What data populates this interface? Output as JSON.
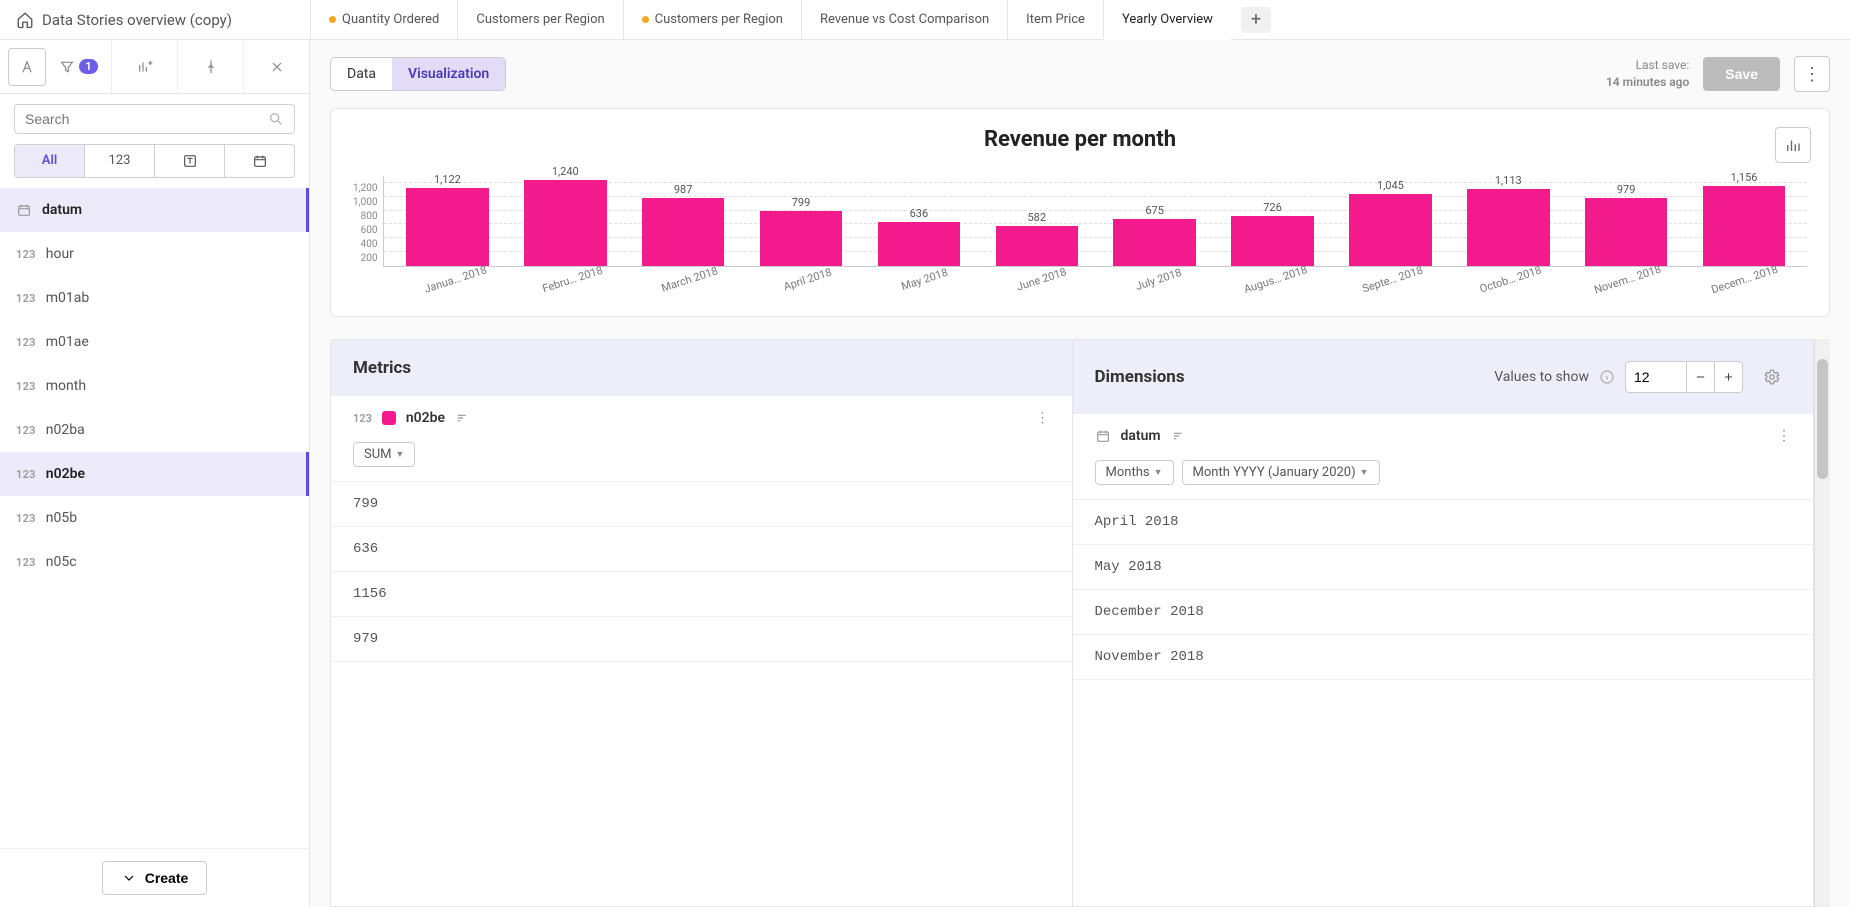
{
  "header": {
    "title": "Data Stories overview (copy)",
    "tabs": [
      {
        "label": "Quantity Ordered",
        "dot": true
      },
      {
        "label": "Customers per Region",
        "dot": false
      },
      {
        "label": "Customers per Region",
        "dot": true
      },
      {
        "label": "Revenue vs Cost Comparison",
        "dot": false
      },
      {
        "label": "Item Price",
        "dot": false
      },
      {
        "label": "Yearly Overview",
        "dot": false,
        "active": true
      }
    ]
  },
  "sidebar": {
    "search_placeholder": "Search",
    "filter_badge": "1",
    "filters": {
      "all": "All",
      "num": "123"
    },
    "items": [
      {
        "type": "date",
        "name": "datum",
        "selected": true
      },
      {
        "type": "123",
        "name": "hour"
      },
      {
        "type": "123",
        "name": "m01ab"
      },
      {
        "type": "123",
        "name": "m01ae"
      },
      {
        "type": "123",
        "name": "month"
      },
      {
        "type": "123",
        "name": "n02ba"
      },
      {
        "type": "123",
        "name": "n02be",
        "selected": true
      },
      {
        "type": "123",
        "name": "n05b"
      },
      {
        "type": "123",
        "name": "n05c"
      }
    ],
    "create_label": "Create"
  },
  "main": {
    "toggle": {
      "data": "Data",
      "viz": "Visualization"
    },
    "last_save_label": "Last save:",
    "last_save_value": "14 minutes ago",
    "save_label": "Save"
  },
  "chart_data": {
    "type": "bar",
    "title": "Revenue per month",
    "categories": [
      "Janua… 2018",
      "Febru… 2018",
      "March 2018",
      "April 2018",
      "May 2018",
      "June 2018",
      "July 2018",
      "Augus… 2018",
      "Septe… 2018",
      "Octob… 2018",
      "Novem… 2018",
      "Decem… 2018"
    ],
    "values": [
      1122,
      1240,
      987,
      799,
      636,
      582,
      675,
      726,
      1045,
      1113,
      979,
      1156
    ],
    "y_ticks": [
      "1,200",
      "1,000",
      "800",
      "600",
      "400",
      "200"
    ],
    "ylim": [
      0,
      1300
    ],
    "color": "#f31a8e"
  },
  "config": {
    "metrics_title": "Metrics",
    "dimensions_title": "Dimensions",
    "values_to_show_label": "Values to show",
    "values_to_show": "12",
    "metric": {
      "type": "123",
      "name": "n02be",
      "agg": "SUM"
    },
    "dimension": {
      "name": "datum",
      "unit": "Months",
      "format": "Month YYYY (January 2020)"
    },
    "rows": [
      {
        "metric": "799",
        "dim": "April 2018"
      },
      {
        "metric": "636",
        "dim": "May 2018"
      },
      {
        "metric": "1156",
        "dim": "December 2018"
      },
      {
        "metric": "979",
        "dim": "November 2018"
      }
    ]
  }
}
